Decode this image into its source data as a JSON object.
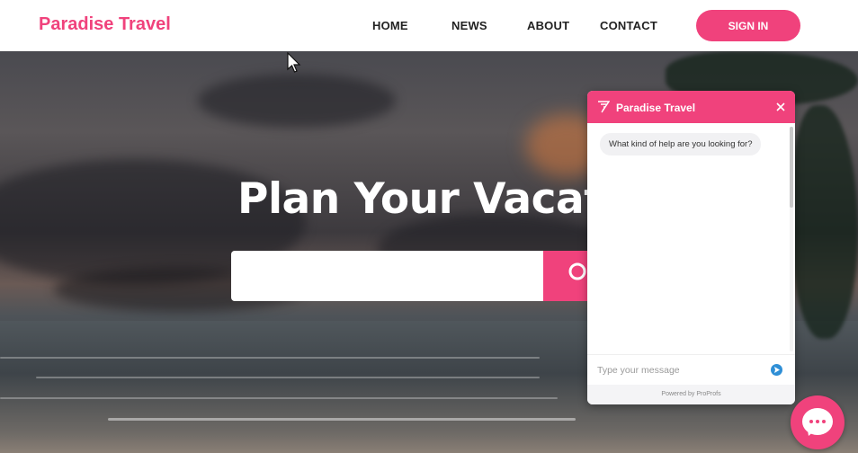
{
  "header": {
    "brand": "Paradise Travel",
    "nav": [
      "HOME",
      "NEWS",
      "ABOUT",
      "CONTACT"
    ],
    "sign_in": "SIGN IN"
  },
  "hero": {
    "title": "Plan Your Vacation",
    "search": {
      "value": "",
      "placeholder": ""
    },
    "search_icon": "search-icon"
  },
  "chat": {
    "title": "Paradise Travel",
    "bot_message": "What kind of help are you looking for?",
    "input_placeholder": "Type your message",
    "powered_by": "Powered by ProProfs",
    "close_icon": "close-icon",
    "send_icon": "send-icon",
    "launcher_icon": "chat-bubble-icon"
  },
  "colors": {
    "accent": "#f0427c",
    "send": "#2f8fd6"
  }
}
